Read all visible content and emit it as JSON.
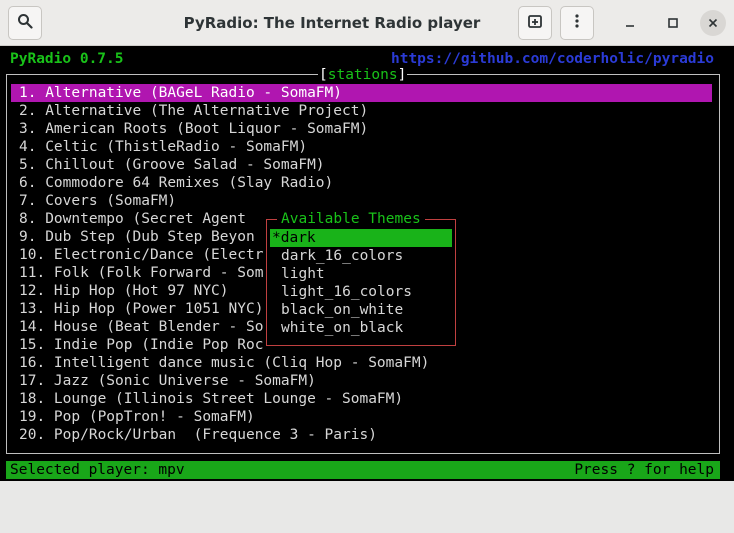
{
  "window": {
    "title": "PyRadio: The Internet Radio player",
    "icons": {
      "search": "search-icon",
      "new_tab": "new-tab-icon",
      "menu": "kebab-menu-icon",
      "minimize": "minimize-icon",
      "maximize": "maximize-icon",
      "close": "close-icon"
    }
  },
  "terminal": {
    "app_version": "PyRadio 0.7.5",
    "repo_url": "https://github.com/coderholic/pyradio",
    "frame_title": "stations",
    "stations": [
      "1. Alternative (BAGeL Radio - SomaFM)",
      "2. Alternative (The Alternative Project)",
      "3. American Roots (Boot Liquor - SomaFM)",
      "4. Celtic (ThistleRadio - SomaFM)",
      "5. Chillout (Groove Salad - SomaFM)",
      "6. Commodore 64 Remixes (Slay Radio)",
      "7. Covers (SomaFM)",
      "8. Downtempo (Secret Agent",
      "9. Dub Step (Dub Step Beyon",
      "10. Electronic/Dance (Electr",
      "11. Folk (Folk Forward - Som",
      "12. Hip Hop (Hot 97 NYC)",
      "13. Hip Hop (Power 1051 NYC)",
      "14. House (Beat Blender - So",
      "15. Indie Pop (Indie Pop Roc",
      "16. Intelligent dance music (Cliq Hop - SomaFM)",
      "17. Jazz (Sonic Universe - SomaFM)",
      "18. Lounge (Illinois Street Lounge - SomaFM)",
      "19. Pop (PopTron! - SomaFM)",
      "20. Pop/Rock/Urban  (Frequence 3 - Paris)"
    ],
    "themes": {
      "title": "Available Themes",
      "items": [
        "*dark",
        "dark_16_colors",
        "light",
        "light_16_colors",
        "black_on_white",
        "white_on_black"
      ]
    },
    "status": {
      "left": "Selected player: mpv",
      "right": "Press ? for help"
    }
  },
  "colors": {
    "selected_station": "#b016b0",
    "active_theme": "#19b319",
    "status_bar": "#19a619",
    "header_green": "#19c219",
    "url_blue": "#2b3bd6",
    "popup_border": "#c04040"
  }
}
